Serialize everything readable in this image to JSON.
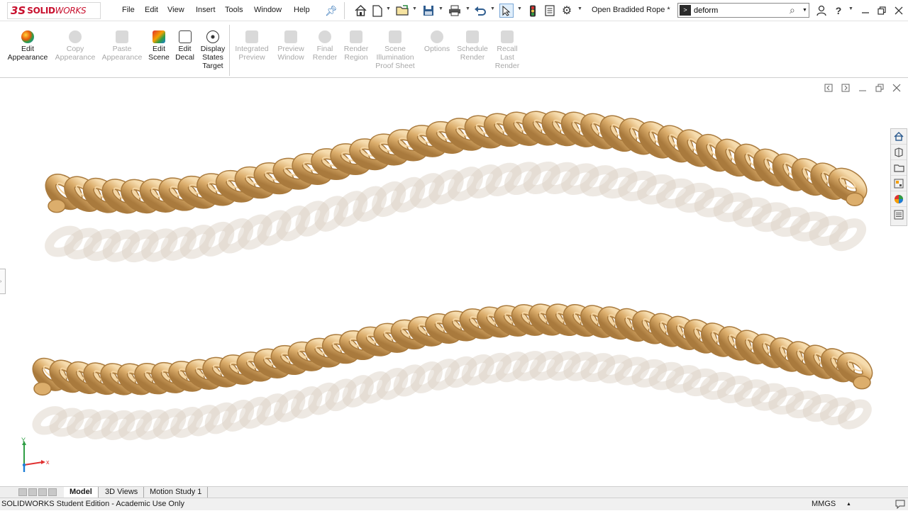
{
  "app": {
    "logo_ds": "3S",
    "logo_solid": "SOLID",
    "logo_works": "WORKS",
    "document_title": "Open Bradided Rope *"
  },
  "menu": [
    "File",
    "Edit",
    "View",
    "Insert",
    "Tools",
    "Window",
    "Help"
  ],
  "search": {
    "value": "deform"
  },
  "command_manager": [
    {
      "label_1": "Edit",
      "label_2": "Appearance",
      "enabled": true,
      "icon": "edit-appearance-icon"
    },
    {
      "label_1": "Copy",
      "label_2": "Appearance",
      "enabled": false,
      "icon": "copy-appearance-icon"
    },
    {
      "label_1": "Paste",
      "label_2": "Appearance",
      "enabled": false,
      "icon": "paste-appearance-icon"
    },
    {
      "label_1": "Edit",
      "label_2": "Scene",
      "enabled": true,
      "icon": "edit-scene-icon"
    },
    {
      "label_1": "Edit",
      "label_2": "Decal",
      "enabled": true,
      "icon": "edit-decal-icon"
    },
    {
      "label_1": "Display",
      "label_2": "States",
      "label_3": "Target",
      "enabled": true,
      "icon": "display-states-target-icon"
    },
    {
      "label_1": "Integrated",
      "label_2": "Preview",
      "enabled": false,
      "icon": "integrated-preview-icon"
    },
    {
      "label_1": "Preview",
      "label_2": "Window",
      "enabled": false,
      "icon": "preview-window-icon"
    },
    {
      "label_1": "Final",
      "label_2": "Render",
      "enabled": false,
      "icon": "final-render-icon"
    },
    {
      "label_1": "Render",
      "label_2": "Region",
      "enabled": false,
      "icon": "render-region-icon"
    },
    {
      "label_1": "Scene",
      "label_2": "Illumination",
      "label_3": "Proof Sheet",
      "enabled": false,
      "icon": "scene-illumination-icon"
    },
    {
      "label_1": "Options",
      "enabled": false,
      "icon": "options-icon"
    },
    {
      "label_1": "Schedule",
      "label_2": "Render",
      "enabled": false,
      "icon": "schedule-render-icon"
    },
    {
      "label_1": "Recall",
      "label_2": "Last",
      "label_3": "Render",
      "enabled": false,
      "icon": "recall-last-render-icon"
    }
  ],
  "triad": {
    "x_label": "x",
    "y_label": "Y"
  },
  "bottom_tabs": [
    "Model",
    "3D Views",
    "Motion Study 1"
  ],
  "status": {
    "text": "SOLIDWORKS Student Edition - Academic Use Only",
    "units": "MMGS"
  },
  "colors": {
    "brand_red": "#c8102e",
    "rope_light": "#f3d3a0",
    "rope_mid": "#dcae6c",
    "rope_dark": "#a97a3d"
  }
}
